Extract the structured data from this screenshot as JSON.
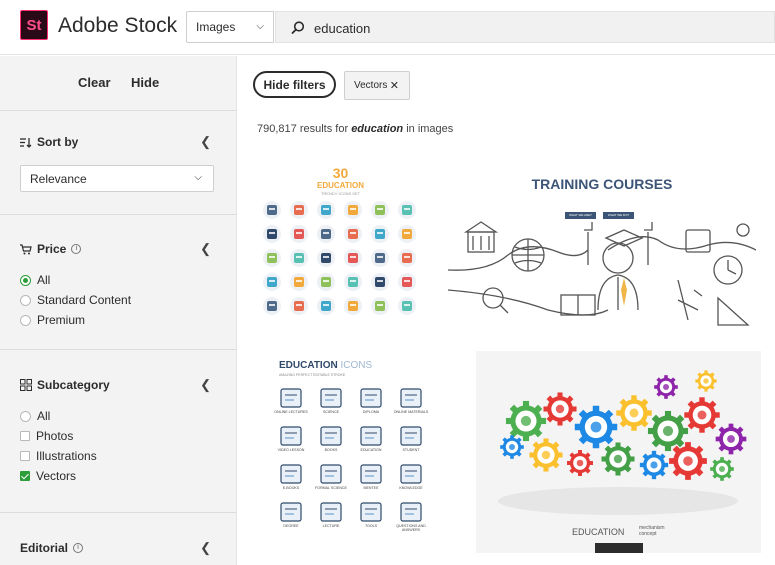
{
  "header": {
    "logo_text": "St",
    "brand": "Adobe Stock",
    "type_select": "Images",
    "search_value": "education"
  },
  "sidebar": {
    "clear_label": "Clear",
    "hide_label": "Hide",
    "sort": {
      "title": "Sort by",
      "value": "Relevance"
    },
    "price": {
      "title": "Price",
      "options": [
        "All",
        "Standard Content",
        "Premium"
      ],
      "selected": "All"
    },
    "subcategory": {
      "title": "Subcategory",
      "options": [
        "All",
        "Photos",
        "Illustrations",
        "Vectors"
      ],
      "selected": "Vectors"
    },
    "editorial": {
      "title": "Editorial"
    }
  },
  "main": {
    "hide_filters_label": "Hide filters",
    "chip_label": "Vectors",
    "results_count": "790,817",
    "results_for": "results for",
    "results_query": "education",
    "results_suffix": "in images"
  },
  "tiles": {
    "t1": {
      "number": "30",
      "title": "EDUCATION",
      "subtitle": "TRENDY ICONS SET"
    },
    "t2": {
      "title": "TRAINING COURSES",
      "btn1": "WHAT WE ARE?",
      "btn2": "WHAT WE DO?"
    },
    "t3": {
      "title": "EDUCATION",
      "title2": "ICONS",
      "subtitle": "AMAZING PERFECT EDITABLE STROKE",
      "labels": [
        "ONLINE LECTURES",
        "SCIENCE",
        "DIPLOMA",
        "ONLINE MATERIALS",
        "VIDEO LESSON",
        "BOOKS",
        "EDUCATION",
        "STUDENT",
        "E-BOOKS",
        "FORMAL SCIENCE",
        "MENTEE",
        "KNOWLEDGE",
        "DEGREE",
        "LECTURE",
        "TOOLS",
        "QUESTIONS AND ANSWERS"
      ]
    },
    "t4": {
      "title": "EDUCATION",
      "word1": "mechanism",
      "word2": "concept"
    }
  },
  "colors": {
    "accent_green": "#2d9d3a",
    "logo_pink": "#ff2e70",
    "navy": "#2f4a6b"
  }
}
